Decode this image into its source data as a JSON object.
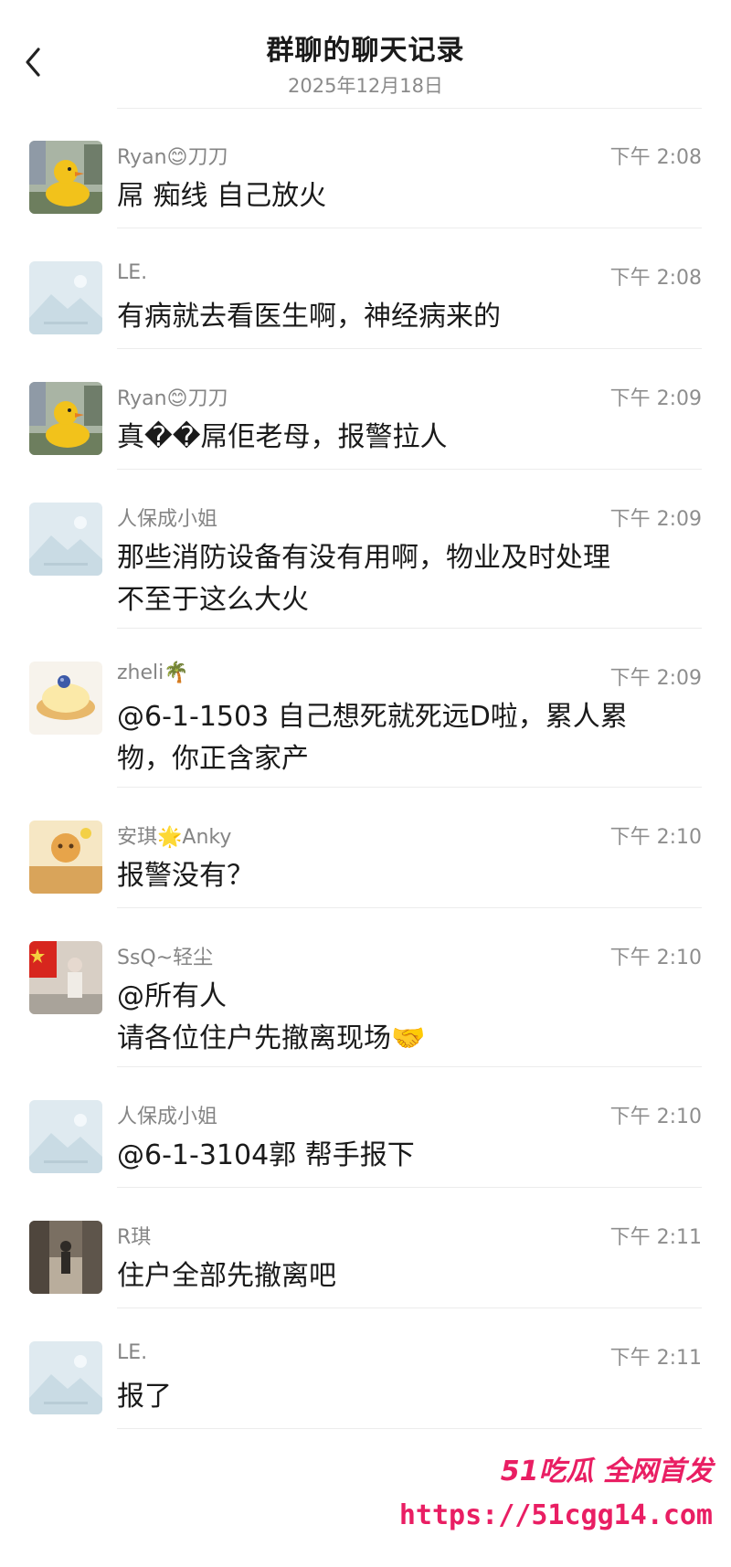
{
  "header": {
    "title": "群聊的聊天记录",
    "date": "2025年12月18日"
  },
  "messages": [
    {
      "sender": "Ryan😊刀刀",
      "time": "下午 2:08",
      "text": "屌 痴线 自己放火",
      "avatar": "yellow-duck-avatar"
    },
    {
      "sender": "LE.",
      "time": "下午 2:08",
      "text": "有病就去看医生啊，神经病来的",
      "avatar": "default-placeholder-avatar"
    },
    {
      "sender": "Ryan😊刀刀",
      "time": "下午 2:09",
      "text": "真��屌佢老母，报警拉人",
      "avatar": "yellow-duck-avatar"
    },
    {
      "sender": "人保成小姐",
      "time": "下午 2:09",
      "text": "那些消防设备有没有用啊，物业及时处理\n不至于这么大火",
      "avatar": "default-placeholder-avatar"
    },
    {
      "sender": "zheli🌴",
      "time": "下午 2:09",
      "text": "@6-1-1503 自己想死就死远D啦，累人累\n物，你正含家产",
      "avatar": "cake-avatar"
    },
    {
      "sender": "安琪🌟Anky",
      "time": "下午 2:10",
      "text": "报警没有？",
      "avatar": "cartoon-avatar"
    },
    {
      "sender": "SsQ~轻尘",
      "time": "下午 2:10",
      "text": "@所有人\n请各位住户先撤离现场🤝",
      "avatar": "flag-person-avatar"
    },
    {
      "sender": "人保成小姐",
      "time": "下午 2:10",
      "text": "@6-1-3104郭 帮手报下",
      "avatar": "default-placeholder-avatar"
    },
    {
      "sender": "R琪",
      "time": "下午 2:11",
      "text": "住户全部先撤离吧",
      "avatar": "street-person-avatar"
    },
    {
      "sender": "LE.",
      "time": "下午 2:11",
      "text": "报了",
      "avatar": "default-placeholder-avatar"
    }
  ],
  "watermark": {
    "brand": "51吃瓜 全网首发",
    "url": "https://51cgg14.com"
  },
  "colors": {
    "watermark": "#e91e63",
    "meta_text": "#858585",
    "divider": "#ececec"
  }
}
